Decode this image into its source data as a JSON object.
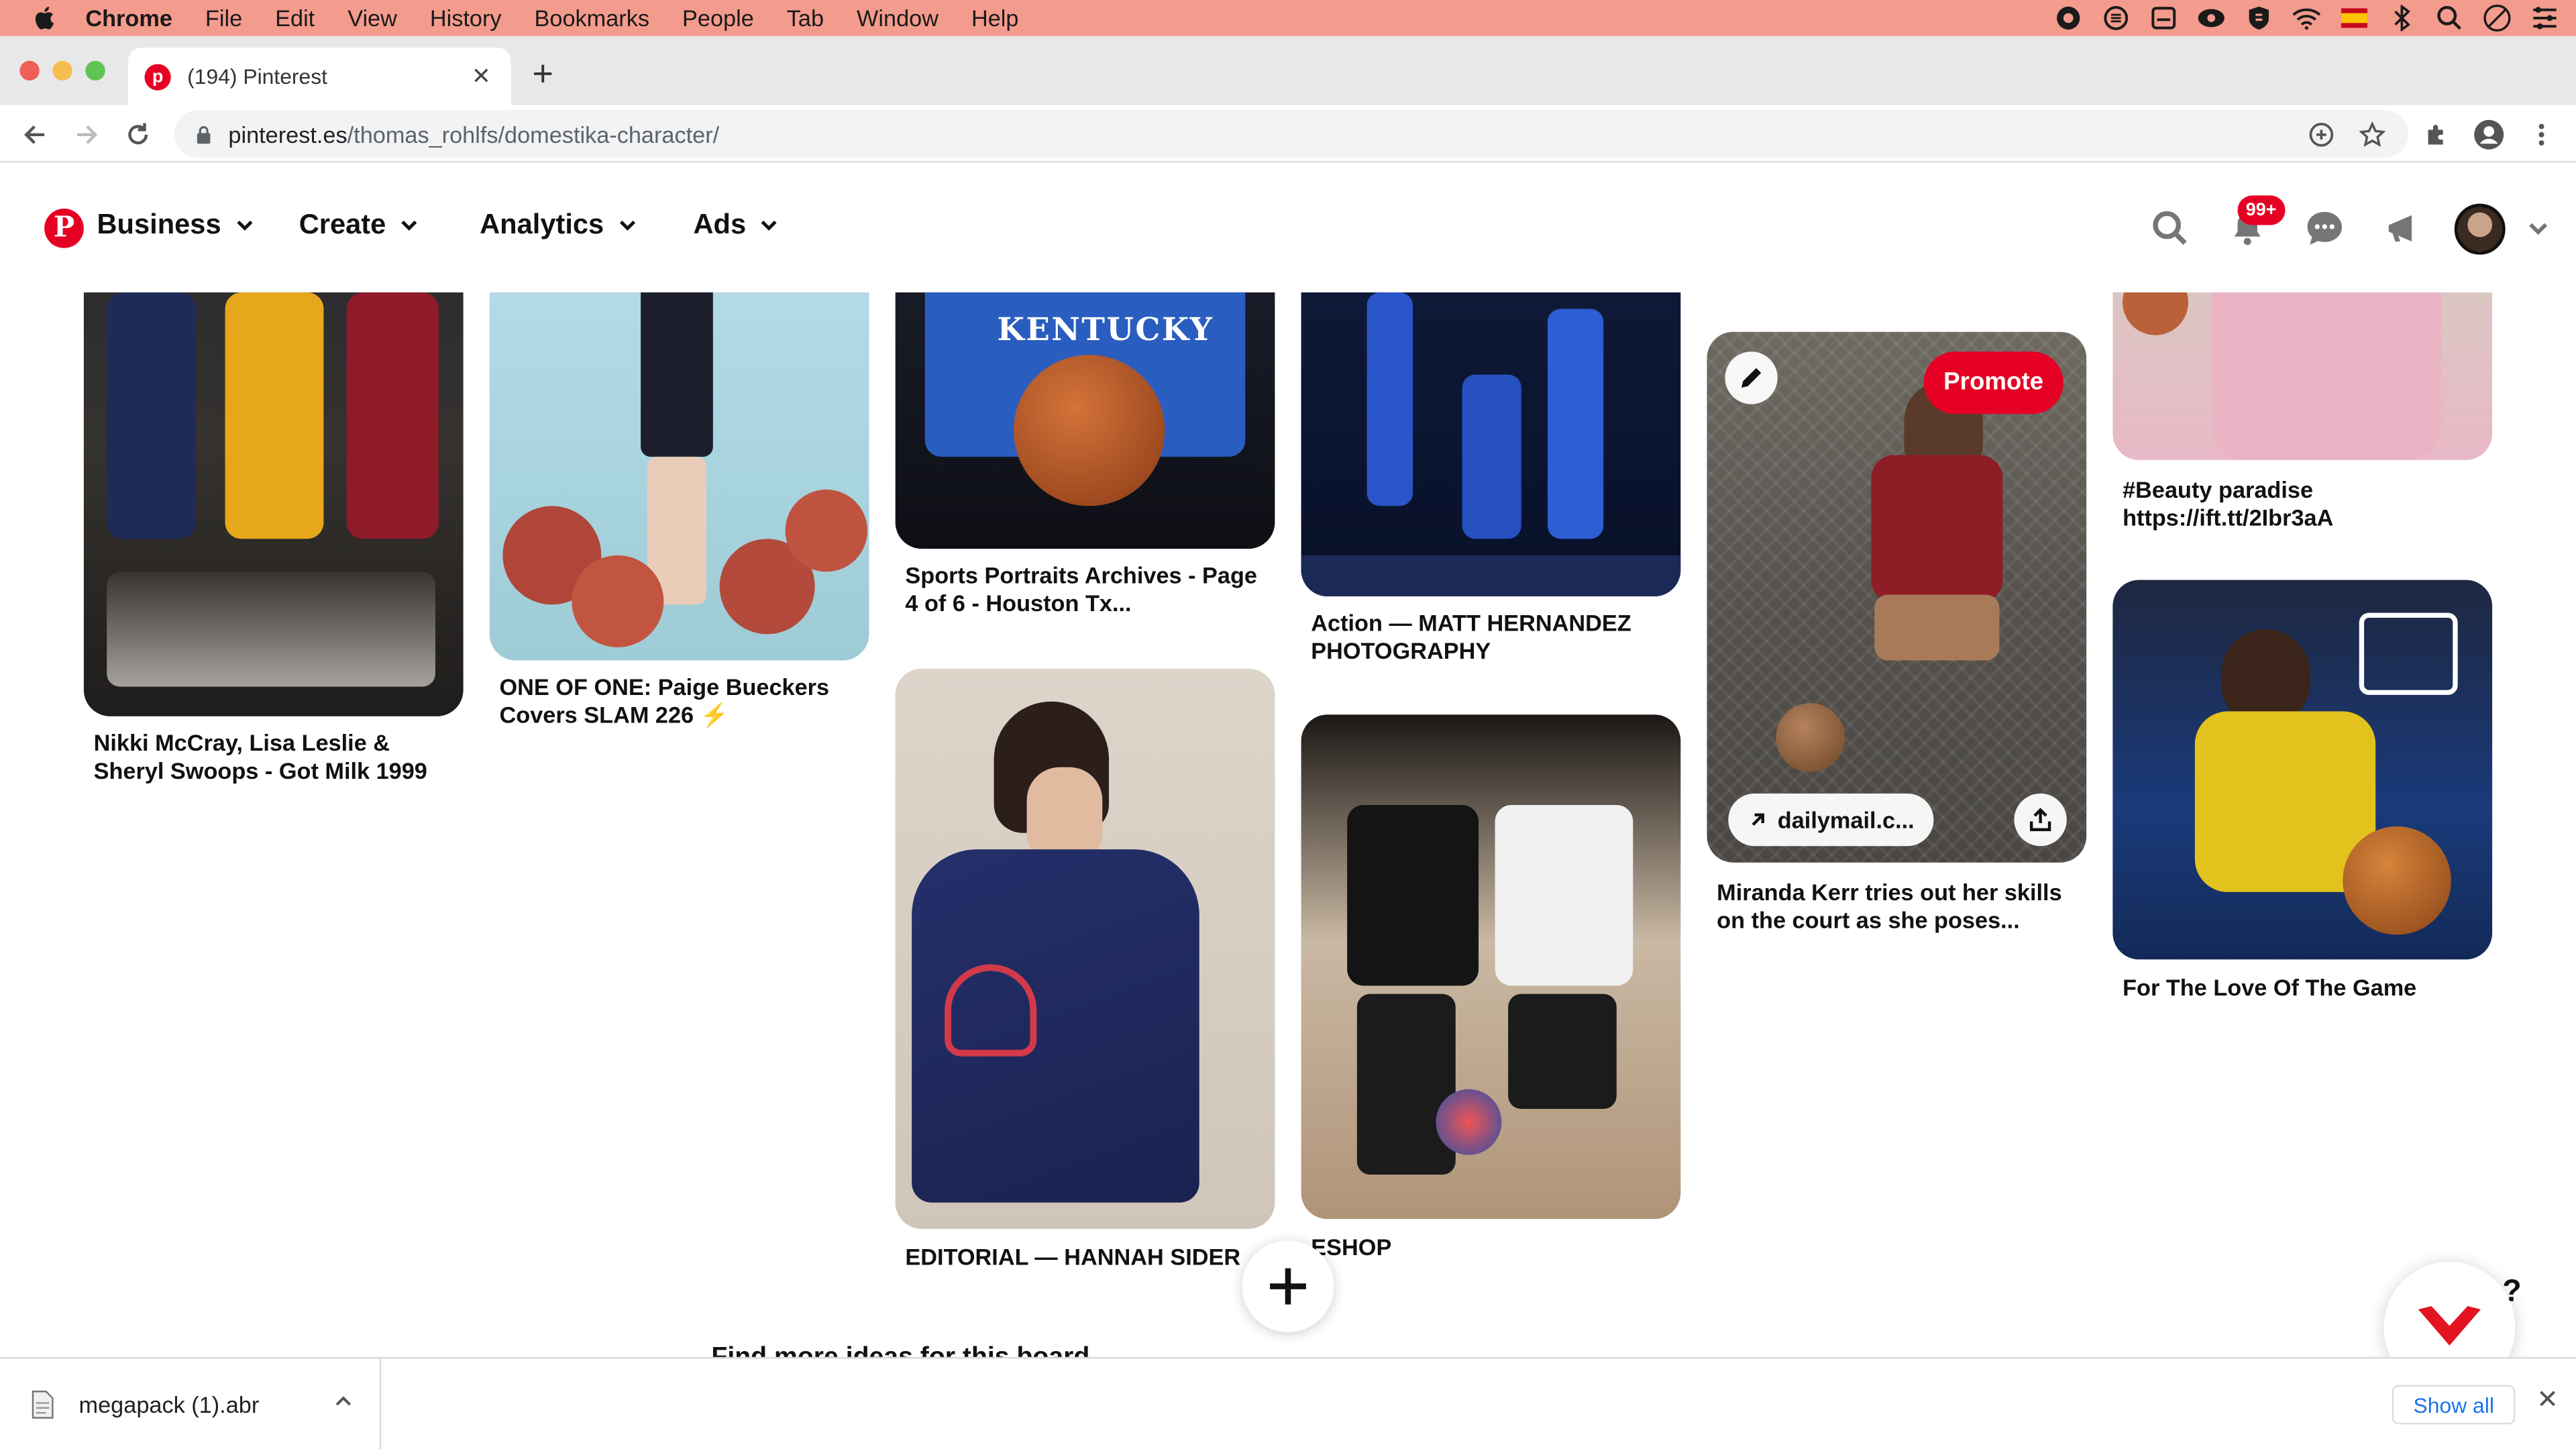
{
  "menubar": {
    "app": "Chrome",
    "items": [
      "File",
      "Edit",
      "View",
      "History",
      "Bookmarks",
      "People",
      "Tab",
      "Window",
      "Help"
    ]
  },
  "browser": {
    "tab_title": "(194) Pinterest",
    "url_host": "pinterest.es",
    "url_path": "/thomas_rohlfs/domestika-character/"
  },
  "pinterest": {
    "nav": {
      "business": "Business",
      "create": "Create",
      "analytics": "Analytics",
      "ads": "Ads"
    },
    "notifications_badge": "99+",
    "pins": [
      {
        "title": "Nikki McCray, Lisa Leslie & Sheryl Swoops - Got Milk 1999"
      },
      {
        "title": "ONE OF ONE: Paige Bueckers Covers SLAM 226 ⚡"
      },
      {
        "title": "Sports Portraits Archives - Page 4 of 6 - Houston Tx..."
      },
      {
        "title": "EDITORIAL — HANNAH SIDER"
      },
      {
        "title": "Action — MATT HERNANDEZ PHOTOGRAPHY"
      },
      {
        "title": "ESHOP"
      },
      {
        "title": "Miranda Kerr tries out her skills on the court as she poses..."
      },
      {
        "title": "#Beauty paradise https://ift.tt/2Ibr3aA"
      },
      {
        "title": "For The Love Of The Game"
      }
    ],
    "hover_pin": {
      "promote_label": "Promote",
      "link_label": "dailymail.c..."
    },
    "help_label": "?",
    "bottom_heading_partial": "Find more ideas for this board"
  },
  "downloads": {
    "file_name": "megapack (1).abr",
    "show_all": "Show all"
  },
  "colors": {
    "pinterest_red": "#e60023",
    "menubar": "#f39b8c",
    "link_blue": "#1a73e8"
  }
}
